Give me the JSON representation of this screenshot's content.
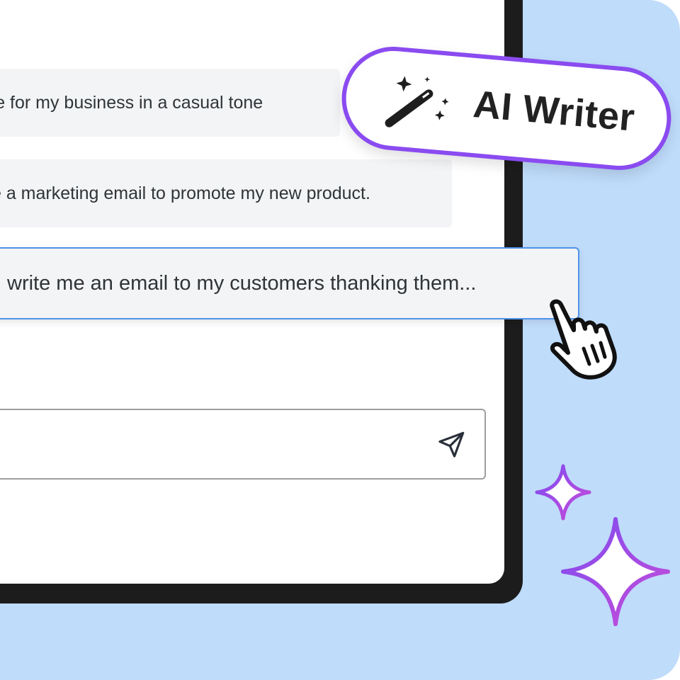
{
  "prompts": [
    {
      "text": "Create an email about our summer sale for my business in a casual tone"
    },
    {
      "text": "Write a marketing email to promote my new product."
    }
  ],
  "active_prompt": {
    "text": "write me an email to my customers thanking them..."
  },
  "input": {
    "placeholder": ""
  },
  "badge": {
    "title": "AI Writer",
    "icon": "magic-wand-icon"
  },
  "icons": {
    "send": "send-icon",
    "cursor": "hand-pointer-icon",
    "sparkle": "sparkle-icon"
  },
  "colors": {
    "background": "#bfdcfb",
    "device_bezel": "#1c1c1c",
    "screen": "#ffffff",
    "prompt_bg": "#f3f4f6",
    "active_border": "#4f93e8",
    "accent_purple": "#8a4bf0",
    "text": "#2f3437"
  }
}
